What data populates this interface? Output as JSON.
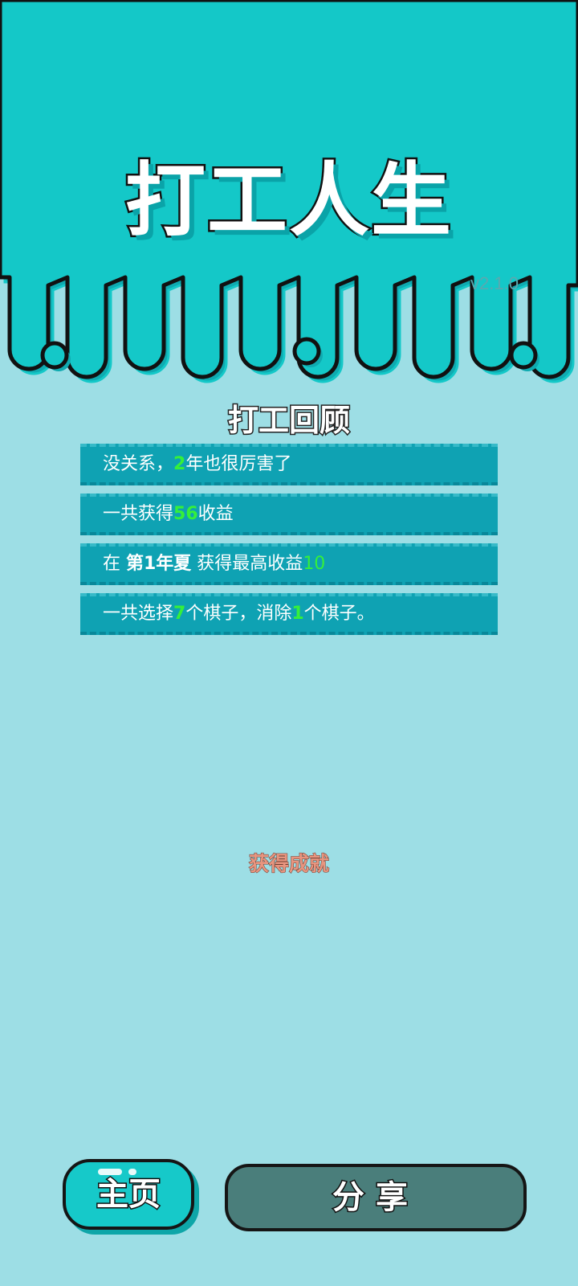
{
  "app": {
    "title": "打工人生",
    "version": "v2.1.0"
  },
  "review": {
    "title": "打工回顾",
    "row1": {
      "prefix": "没关系，",
      "years": "2",
      "suffix": "年也很厉害了"
    },
    "row2": {
      "prefix": "一共获得",
      "total": "56",
      "suffix": "收益"
    },
    "row3": {
      "prefix": "在 ",
      "period": "第1年夏",
      "middle": " 获得最高收益",
      "max": "10"
    },
    "row4": {
      "prefix": "一共选择",
      "chosen": "7",
      "middle": "个棋子，消除",
      "removed": "1",
      "suffix": "个棋子。"
    }
  },
  "achievement": {
    "label": "获得成就"
  },
  "buttons": {
    "home_label": "主页",
    "share_label": "分享"
  },
  "colors": {
    "top": "#14c8c8",
    "background": "#9ddee5",
    "row": "#0fa2b3",
    "highlight": "#35f03a",
    "share_button": "#4a7e7b"
  }
}
